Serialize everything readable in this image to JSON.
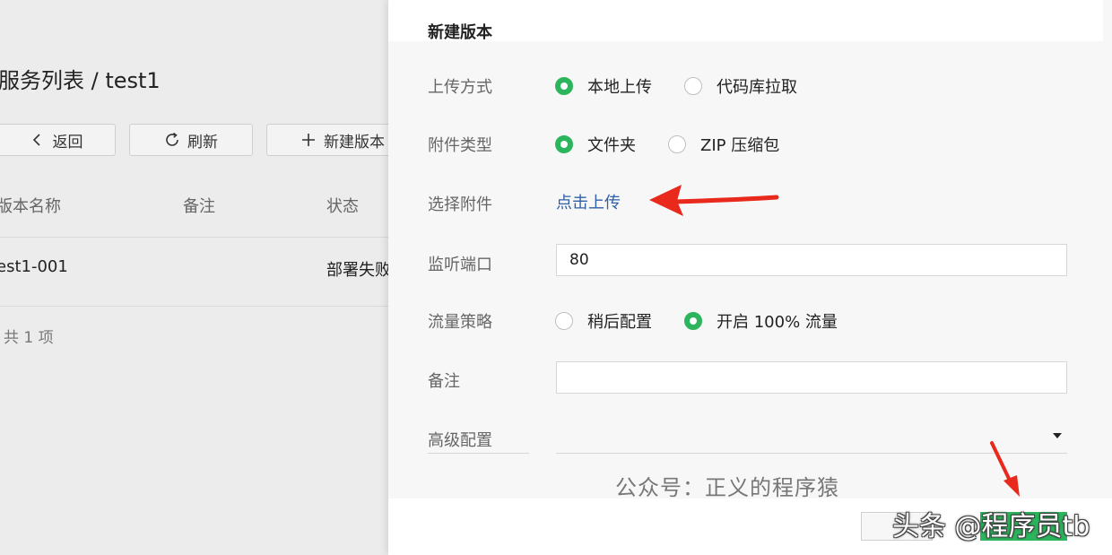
{
  "background_page": {
    "title": "服务列表 / test1",
    "buttons": {
      "back": "返回",
      "refresh": "刷新",
      "new_version": "新建版本"
    },
    "table": {
      "headers": [
        "版本名称",
        "备注",
        "状态"
      ],
      "rows": [
        {
          "name": "est1-001",
          "remark": "",
          "status": "部署失败"
        }
      ],
      "total": "共 1 项"
    }
  },
  "drawer": {
    "title": "新建版本",
    "upload_method": {
      "label": "上传方式",
      "options": [
        "本地上传",
        "代码库拉取"
      ],
      "selected": "本地上传"
    },
    "attachment_type": {
      "label": "附件类型",
      "options": [
        "文件夹",
        "ZIP 压缩包"
      ],
      "selected": "文件夹"
    },
    "attachment": {
      "label": "选择附件",
      "link": "点击上传"
    },
    "port": {
      "label": "监听端口",
      "value": "80"
    },
    "traffic": {
      "label": "流量策略",
      "options": [
        "稍后配置",
        "开启 100% 流量"
      ],
      "selected": "开启 100% 流量"
    },
    "remark": {
      "label": "备注",
      "value": ""
    },
    "advanced": {
      "label": "高级配置"
    },
    "watermark_text": "公众号：正义的程序猿",
    "footer_watermark": "头条 @程序员tb"
  },
  "colors": {
    "accent_green": "#2db55d",
    "link_blue": "#2e5fa7",
    "arrow_red": "#e8291c"
  }
}
